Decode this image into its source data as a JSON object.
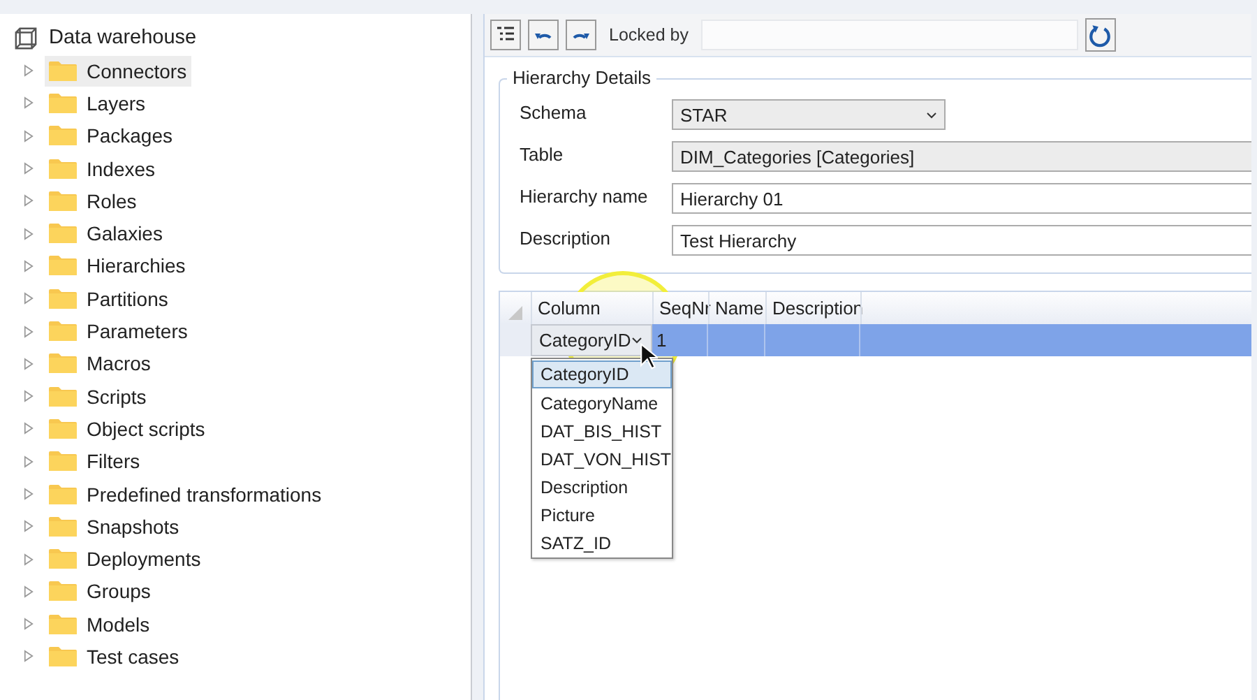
{
  "tree": {
    "root": "Data warehouse",
    "items": [
      {
        "label": "Connectors",
        "selected": true,
        "expanded": false
      },
      {
        "label": "Layers",
        "selected": false,
        "expanded": false
      },
      {
        "label": "Packages",
        "selected": false,
        "expanded": false
      },
      {
        "label": "Indexes",
        "selected": false,
        "expanded": false
      },
      {
        "label": "Roles",
        "selected": false,
        "expanded": false
      },
      {
        "label": "Galaxies",
        "selected": false,
        "expanded": false
      },
      {
        "label": "Hierarchies",
        "selected": false,
        "expanded": false
      },
      {
        "label": "Partitions",
        "selected": false,
        "expanded": false
      },
      {
        "label": "Parameters",
        "selected": false,
        "expanded": false
      },
      {
        "label": "Macros",
        "selected": false,
        "expanded": false
      },
      {
        "label": "Scripts",
        "selected": false,
        "expanded": false
      },
      {
        "label": "Object scripts",
        "selected": false,
        "expanded": false
      },
      {
        "label": "Filters",
        "selected": false,
        "expanded": false
      },
      {
        "label": "Predefined transformations",
        "selected": false,
        "expanded": false
      },
      {
        "label": "Snapshots",
        "selected": false,
        "expanded": false
      },
      {
        "label": "Deployments",
        "selected": false,
        "expanded": false
      },
      {
        "label": "Groups",
        "selected": false,
        "expanded": false
      },
      {
        "label": "Models",
        "selected": false,
        "expanded": false
      },
      {
        "label": "Test cases",
        "selected": false,
        "expanded": false
      }
    ]
  },
  "toolbar": {
    "buttons": [
      {
        "kind": "list"
      },
      {
        "kind": "undo"
      },
      {
        "kind": "redo"
      }
    ],
    "locked_by_label": "Locked by",
    "refresh": {
      "kind": "refresh"
    }
  },
  "details": {
    "legend": "Hierarchy Details",
    "fields": [
      {
        "label": "Schema",
        "kind": "select",
        "value": "STAR"
      },
      {
        "label": "Table",
        "kind": "readonly",
        "value": "DIM_Categories [Categories]"
      },
      {
        "label": "Hierarchy name",
        "kind": "text",
        "value": "Hierarchy 01"
      },
      {
        "label": "Description",
        "kind": "text",
        "value": "Test Hierarchy"
      }
    ]
  },
  "grid": {
    "columns": [
      "Column",
      "SeqNr",
      "Name",
      "Description"
    ],
    "rows": [
      {
        "selected": true,
        "column": "CategoryID",
        "seqnr": "1"
      }
    ],
    "dropdown": {
      "options": [
        {
          "label": "CategoryID",
          "selected": true
        },
        {
          "label": "CategoryName",
          "selected": false
        },
        {
          "label": "DAT_BIS_HIST",
          "selected": false
        },
        {
          "label": "DAT_VON_HIST",
          "selected": false
        },
        {
          "label": "Description",
          "selected": false
        },
        {
          "label": "Picture",
          "selected": false
        },
        {
          "label": "SATZ_ID",
          "selected": false
        }
      ]
    }
  }
}
